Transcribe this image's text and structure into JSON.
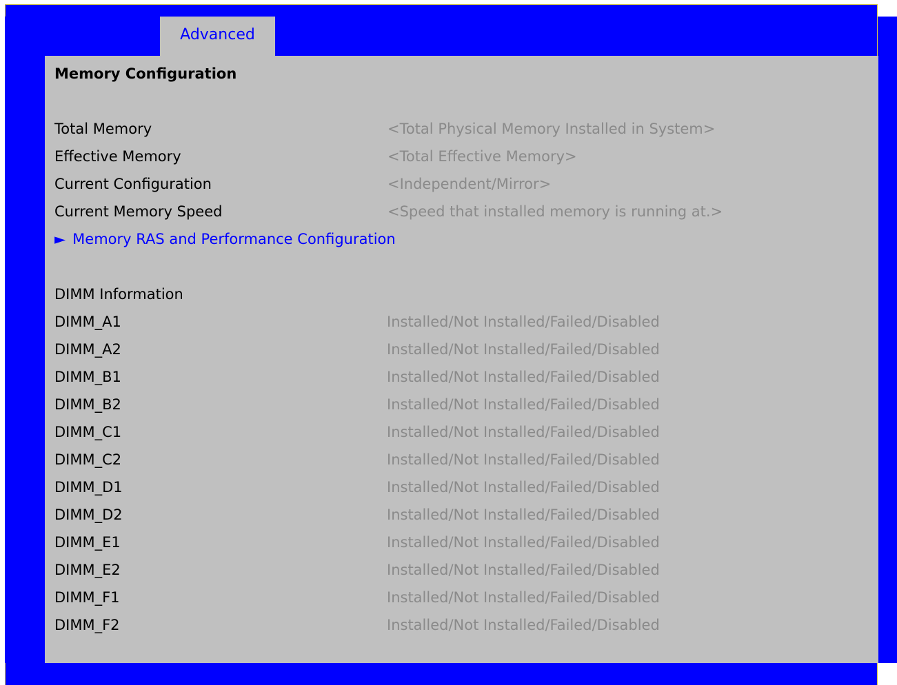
{
  "tabs": [
    {
      "label": "Advanced",
      "active": true
    }
  ],
  "page": {
    "title": "Memory Configuration"
  },
  "info": {
    "total_memory": {
      "label": "Total Memory",
      "value": "<Total Physical Memory Installed in System>"
    },
    "effective_memory": {
      "label": "Effective Memory",
      "value": "<Total Effective Memory>"
    },
    "current_configuration": {
      "label": "Current Configuration",
      "value": "<Independent/Mirror>"
    },
    "current_memory_speed": {
      "label": "Current Memory Speed",
      "value": "<Speed that installed memory is running at.>"
    }
  },
  "submenu": {
    "arrow": "►",
    "label": "Memory RAS and Performance Configuration"
  },
  "dimm": {
    "heading": "DIMM Information",
    "slots": [
      {
        "label": "DIMM_A1",
        "value": "Installed/Not Installed/Failed/Disabled"
      },
      {
        "label": "DIMM_A2",
        "value": "Installed/Not Installed/Failed/Disabled"
      },
      {
        "label": "DIMM_B1",
        "value": "Installed/Not Installed/Failed/Disabled"
      },
      {
        "label": "DIMM_B2",
        "value": "Installed/Not Installed/Failed/Disabled"
      },
      {
        "label": "DIMM_C1",
        "value": "Installed/Not Installed/Failed/Disabled"
      },
      {
        "label": "DIMM_C2",
        "value": "Installed/Not Installed/Failed/Disabled"
      },
      {
        "label": "DIMM_D1",
        "value": "Installed/Not Installed/Failed/Disabled"
      },
      {
        "label": "DIMM_D2",
        "value": "Installed/Not Installed/Failed/Disabled"
      },
      {
        "label": "DIMM_E1",
        "value": "Installed/Not Installed/Failed/Disabled"
      },
      {
        "label": "DIMM_E2",
        "value": "Installed/Not Installed/Failed/Disabled"
      },
      {
        "label": "DIMM_F1",
        "value": "Installed/Not Installed/Failed/Disabled"
      },
      {
        "label": "DIMM_F2",
        "value": "Installed/Not Installed/Failed/Disabled"
      }
    ]
  },
  "colors": {
    "frame": "#0000ff",
    "panel": "#c0c0c0",
    "label": "#000000",
    "value": "#8a8a8a",
    "link": "#0000ff"
  }
}
